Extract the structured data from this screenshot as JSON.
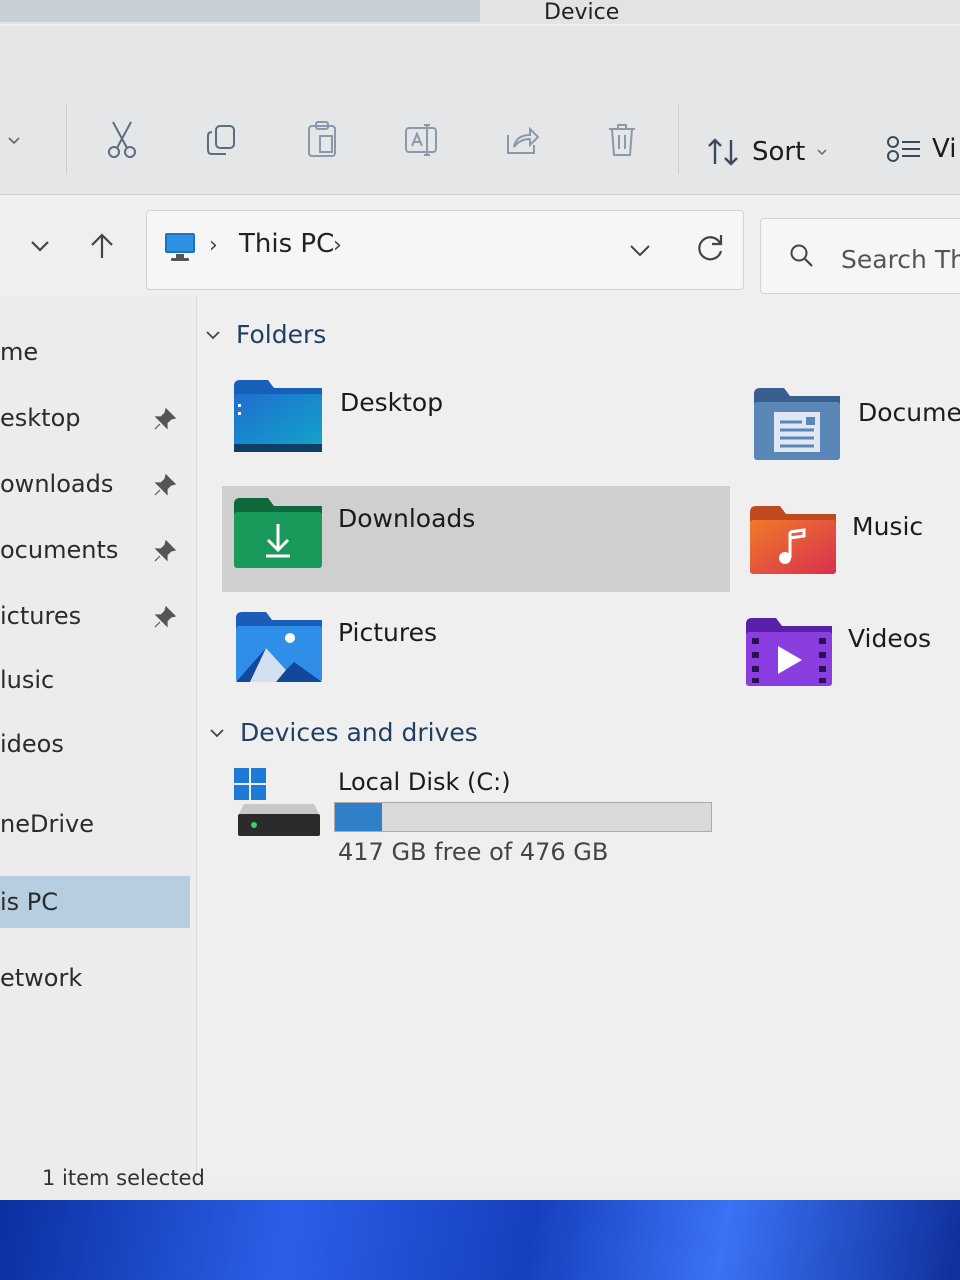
{
  "window": {
    "title_fragment": "Device"
  },
  "toolbar": {
    "buttons": [
      {
        "icon": "cut-icon"
      },
      {
        "icon": "copy-icon"
      },
      {
        "icon": "paste-icon"
      },
      {
        "icon": "rename-icon"
      },
      {
        "icon": "share-icon"
      },
      {
        "icon": "delete-icon"
      }
    ],
    "sort_label": "Sort",
    "view_label": "Vi"
  },
  "address": {
    "crumb": "This PC",
    "search_placeholder": "Search This"
  },
  "sidebar": {
    "items": [
      {
        "label": "me",
        "pinned": false
      },
      {
        "label": "esktop",
        "pinned": true
      },
      {
        "label": "ownloads",
        "pinned": true
      },
      {
        "label": "ocuments",
        "pinned": true
      },
      {
        "label": "ictures",
        "pinned": true
      },
      {
        "label": "lusic",
        "pinned": false
      },
      {
        "label": "ideos",
        "pinned": false
      },
      {
        "label": "neDrive",
        "pinned": false
      },
      {
        "label": "is PC",
        "pinned": false,
        "selected": true
      },
      {
        "label": "etwork",
        "pinned": false
      }
    ]
  },
  "folders": {
    "heading": "Folders",
    "items": [
      {
        "name": "Desktop",
        "icon": "desktop-folder-icon"
      },
      {
        "name": "Documen",
        "icon": "documents-folder-icon"
      },
      {
        "name": "Downloads",
        "icon": "downloads-folder-icon",
        "selected": true
      },
      {
        "name": "Music",
        "icon": "music-folder-icon"
      },
      {
        "name": "Pictures",
        "icon": "pictures-folder-icon"
      },
      {
        "name": "Videos",
        "icon": "videos-folder-icon"
      }
    ]
  },
  "drives": {
    "heading": "Devices and drives",
    "items": [
      {
        "name": "Local Disk (C:)",
        "free_text": "417 GB free of 476 GB",
        "used_fraction": 0.124
      }
    ]
  },
  "status": {
    "text": "1 item selected"
  },
  "colors": {
    "accent": "#2f7fc9",
    "selection": "#cfcfcf",
    "nav_selected": "#b7cde0"
  }
}
